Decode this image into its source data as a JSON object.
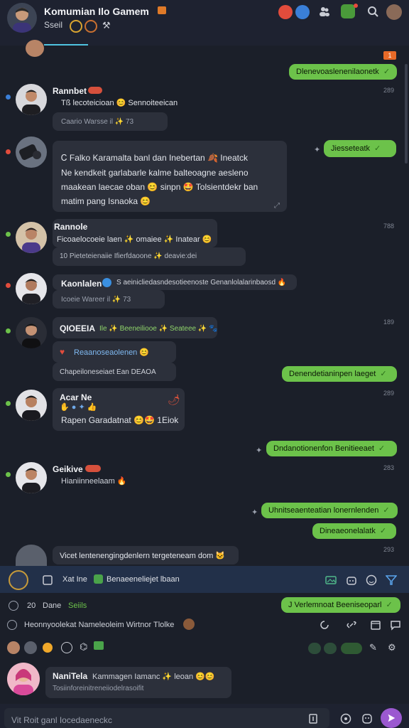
{
  "header": {
    "title": "Komumian Ilo Gamem",
    "subtitle": "Sseil"
  },
  "date_badge": "1",
  "messages_in": [
    {
      "sender": "Rannbet",
      "text": "Tß  lecoteicioan  😊  Sennoiteeican",
      "meta": "Caario  Warsse  il  ✨ 73"
    },
    {
      "sender": "",
      "text_lines": [
        "Ꮯ Falko  Karamalta  banl dan Inebertan 🍂  Ineatck",
        "Ne  kendkeit garlabarle  kalme  balteoagne  aesleno",
        "maakean  laecae oban 😊  sinpn 🤩  Tolsientdekr  ban",
        "matim  pang Isnaoka 😊"
      ]
    },
    {
      "sender": "Rannole",
      "text": "Ficoaelocoeie  laen  ✨ omaiee  ✨ Inatear 😊",
      "meta": "10  Pieteteienaiie  Ifierfdaoone  ✨ deavie:dei"
    },
    {
      "sender": "Kaonlalen",
      "text": "S aeinicliedasndesotieenoste  Genanlolalarinbaosd 🔥",
      "meta": "Icoeie  Wareer  il  ✨ 73"
    },
    {
      "sender": "QIOEEIA",
      "text": "Ile  ✨ Beeneiliooe  ✨ Seateee ✨ 🐾"
    },
    {
      "sender": "",
      "text": "Reaanoseaolenen 😊",
      "meta": "Chapeiloneseiaet  Ean  DEAOA"
    },
    {
      "sender": "Acar Ne",
      "text": "Rapen  Garadatnat 😊🤩  1Eiok"
    },
    {
      "sender": "Geikive",
      "text": "Hianiinneelaam 🔥"
    },
    {
      "sender": "",
      "text": "Vicet  lentenengingdenlern  tergeteneam  dom 🐱"
    }
  ],
  "times": [
    "289",
    "788",
    "189",
    "289",
    "283",
    "293"
  ],
  "messages_out": [
    "Dlenevoaslenenilaonetk",
    "Jiesseteatk",
    "Denendetianinpen  laeget",
    "Dndanotionenfon  Benitieeaet",
    "Uhnitseaenteatian  lonernlenden",
    "Dineaeonelalatk",
    "J  Verlemnoat  Beeniseoparl"
  ],
  "pinned": {
    "label": "Xat  Ine",
    "text": "Benaeeneliejet  lbaan"
  },
  "info_row": {
    "count": "20",
    "label": "Dane",
    "status": "Seiils"
  },
  "typing_row": "Heonnyoolekat  Nameleoleim  Wirtnor Tlolke",
  "profile": {
    "name": "NaniTela",
    "text": "Kammagen  Iamanc  ✨ leoan 😊😊",
    "sub": "Tosiinforeinitreneiiodelrasoifit"
  },
  "composer": {
    "placeholder": "Vit  Roit  ganl  Iocedaeneckc"
  },
  "colors": {
    "accent_green": "#6cc24a",
    "background": "#1b1f29",
    "bubble_in": "#2c303b",
    "send_button": "#9b59d0"
  }
}
